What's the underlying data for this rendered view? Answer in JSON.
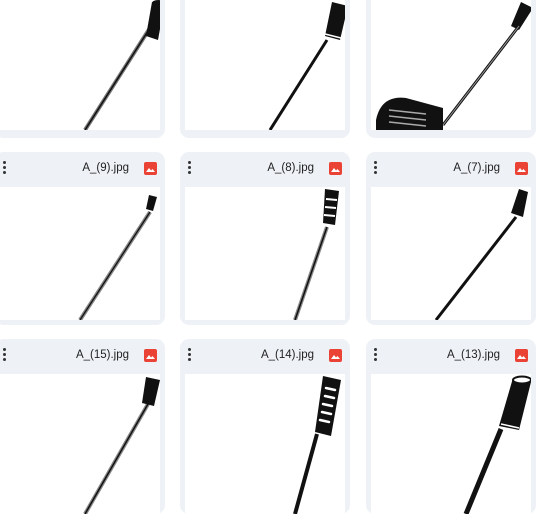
{
  "files": [
    {
      "name": ""
    },
    {
      "name": ""
    },
    {
      "name": ""
    },
    {
      "name": "A_(9).jpg"
    },
    {
      "name": "A_(8).jpg"
    },
    {
      "name": "A_(7).jpg"
    },
    {
      "name": "A_(15).jpg"
    },
    {
      "name": "A_(14).jpg"
    },
    {
      "name": "A_(13).jpg"
    }
  ],
  "icons": {
    "more": "more-vert-icon",
    "image": "image-file-icon"
  },
  "colors": {
    "card_bg": "#eef1f6",
    "image_badge": "#ea4335"
  }
}
